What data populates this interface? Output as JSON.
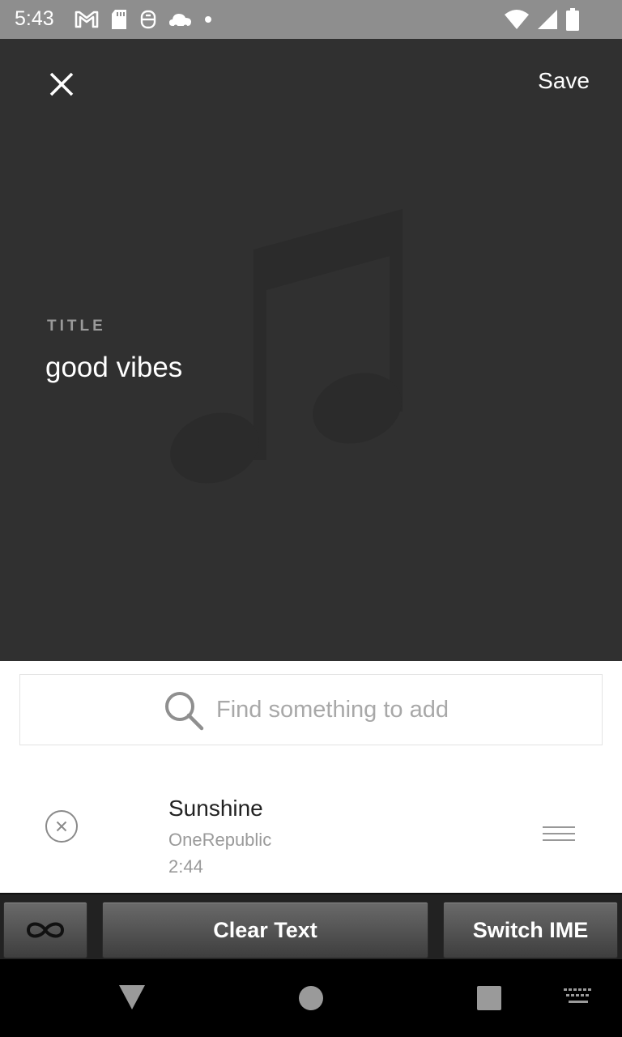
{
  "status_bar": {
    "time": "5:43",
    "left_icons": [
      "gmail-icon",
      "sd-card-icon",
      "robot-icon",
      "cloud-icon",
      "dot-icon"
    ],
    "right_icons": [
      "wifi-icon",
      "cell-signal-icon",
      "battery-icon"
    ]
  },
  "header": {
    "save_label": "Save",
    "title_label": "TITLE",
    "title_value": "good vibes",
    "background_icon": "music-note-icon",
    "background_color": "#303030"
  },
  "search": {
    "placeholder": "Find something to add"
  },
  "tracks": [
    {
      "title": "Sunshine",
      "artist": "OneRepublic",
      "duration": "2:44"
    }
  ],
  "ime_bar": {
    "infinity_icon": "infinity-icon",
    "clear_label": "Clear Text",
    "switch_label": "Switch IME"
  },
  "nav_bar": {
    "icons": [
      "back-icon",
      "home-icon",
      "recents-icon",
      "keyboard-icon"
    ]
  }
}
